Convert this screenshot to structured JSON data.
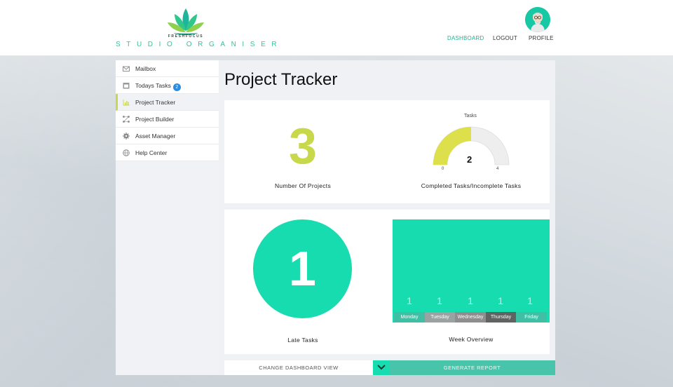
{
  "brand": {
    "tagline": "FRESHFOCUS",
    "name": "STUDIO ORGANISER"
  },
  "nav": {
    "dashboard": "DASHBOARD",
    "logout": "LOGOUT",
    "profile": "PROFILE"
  },
  "sidebar": {
    "items": [
      {
        "label": "Mailbox",
        "icon": "mail-icon"
      },
      {
        "label": "Todays Tasks",
        "icon": "calendar-icon",
        "badge": "2"
      },
      {
        "label": "Project Tracker",
        "icon": "chart-icon",
        "active": true
      },
      {
        "label": "Project Builder",
        "icon": "builder-icon"
      },
      {
        "label": "Asset Manager",
        "icon": "gear-icon"
      },
      {
        "label": "Help Center",
        "icon": "globe-icon"
      }
    ]
  },
  "page": {
    "title": "Project Tracker"
  },
  "projects": {
    "value": "3",
    "label": "Number Of Projects"
  },
  "gauge": {
    "title": "Tasks",
    "value": "2",
    "min": "0",
    "max": "4",
    "fraction": 0.5,
    "label": "Completed Tasks/Incomplete Tasks"
  },
  "late": {
    "value": "1",
    "label": "Late Tasks"
  },
  "week": {
    "label": "Week Overview",
    "days": [
      {
        "day": "Monday",
        "value": "1"
      },
      {
        "day": "Tuesday",
        "value": "1"
      },
      {
        "day": "Wednesday",
        "value": "1"
      },
      {
        "day": "Thursday",
        "value": "1"
      },
      {
        "day": "Friday",
        "value": "1"
      }
    ]
  },
  "footer": {
    "change_view": "CHANGE DASHBOARD VIEW",
    "generate": "GENERATE REPORT"
  },
  "colors": {
    "accent": "#16dcb0",
    "lime": "#c8d84b",
    "gauge_fill": "#dde04a",
    "gauge_empty": "#eeeeee",
    "teal_text": "#2fc4a0",
    "badge": "#2a8be0"
  }
}
